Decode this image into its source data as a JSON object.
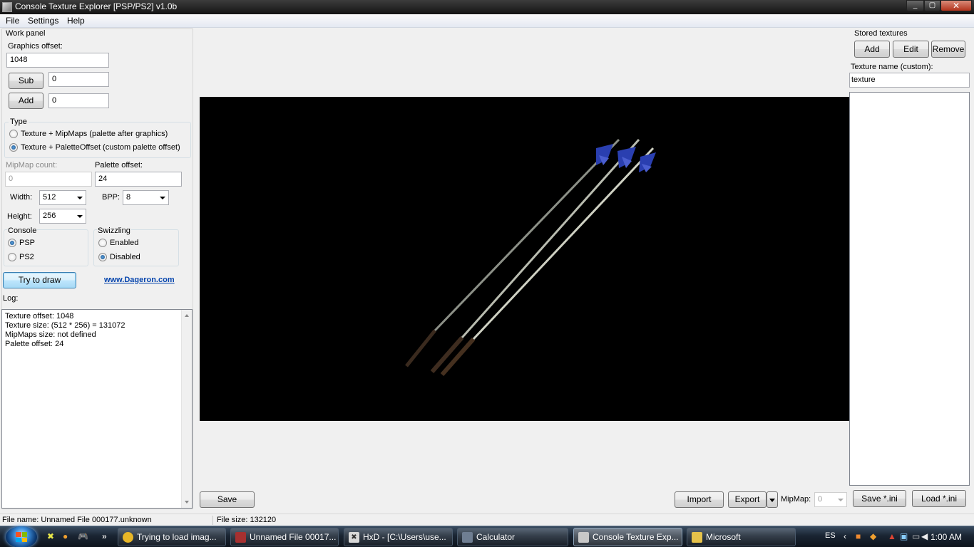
{
  "window": {
    "title": "Console Texture Explorer [PSP/PS2] v1.0b",
    "minimize_glyph": "_",
    "maximize_glyph": "▢",
    "close_glyph": "✕"
  },
  "menu": {
    "items": [
      "File",
      "Settings",
      "Help"
    ]
  },
  "work_panel": {
    "title": "Work panel",
    "graphics_offset_label": "Graphics offset:",
    "graphics_offset_value": "1048",
    "sub_label": "Sub",
    "sub_value": "0",
    "add_label": "Add",
    "add_value": "0",
    "type_label": "Type",
    "type_options": [
      {
        "label": "Texture + MipMaps (palette after graphics)",
        "checked": false
      },
      {
        "label": "Texture + PaletteOffset (custom palette offset)",
        "checked": true
      }
    ],
    "mipmap_count_label": "MipMap count:",
    "mipmap_count_value": "0",
    "palette_offset_label": "Palette offset:",
    "palette_offset_value": "24",
    "width_label": "Width:",
    "width_value": "512",
    "bpp_label": "BPP:",
    "bpp_value": "8",
    "height_label": "Height:",
    "height_value": "256",
    "console_label": "Console",
    "console_options": [
      {
        "label": "PSP",
        "checked": true
      },
      {
        "label": "PS2",
        "checked": false
      }
    ],
    "swizzling_label": "Swizzling",
    "swizzling_options": [
      {
        "label": "Enabled",
        "checked": false
      },
      {
        "label": "Disabled",
        "checked": true
      }
    ],
    "try_draw_label": "Try to draw",
    "website_link": "www.Dageron.com",
    "log_label": "Log:",
    "log_lines": [
      "Texture offset: 1048",
      "Texture size: (512 * 256) = 131072",
      "MipMaps size: not defined",
      "Palette offset: 24"
    ]
  },
  "bottom_bar": {
    "save_label": "Save",
    "import_label": "Import",
    "export_label": "Export",
    "mipmap_label": "MipMap:",
    "mipmap_value": "0",
    "save_ini_label": "Save *.ini",
    "load_ini_label": "Load *.ini"
  },
  "stored": {
    "title": "Stored textures",
    "add_label": "Add",
    "edit_label": "Edit",
    "remove_label": "Remove",
    "name_label": "Texture name (custom):",
    "name_value": "texture"
  },
  "status": {
    "file_name": "File name: Unnamed File 000177.unknown",
    "file_size": "File size: 132120"
  },
  "taskbar": {
    "tasks": [
      {
        "label": "Trying to load imag...",
        "icon": "chrome-icon",
        "color": "#e8b627",
        "active": false
      },
      {
        "label": "Unnamed File 00017...",
        "icon": "archive-icon",
        "color": "#a63030",
        "active": false
      },
      {
        "label": "HxD - [C:\\Users\\use...",
        "icon": "hxd-icon",
        "color": "#d8d8d8",
        "active": false
      },
      {
        "label": "Calculator",
        "icon": "calculator-icon",
        "color": "#6f7e92",
        "active": false
      },
      {
        "label": "Console Texture Exp...",
        "icon": "app-icon",
        "color": "#c8c8c8",
        "active": true
      },
      {
        "label": "Microsoft",
        "icon": "folder-icon",
        "color": "#e6c24a",
        "active": false
      }
    ],
    "language": "ES",
    "time": "1:00 AM"
  },
  "colors": {
    "canvas_bg": "#000000",
    "fletching_blue": "#2a3fb0"
  }
}
